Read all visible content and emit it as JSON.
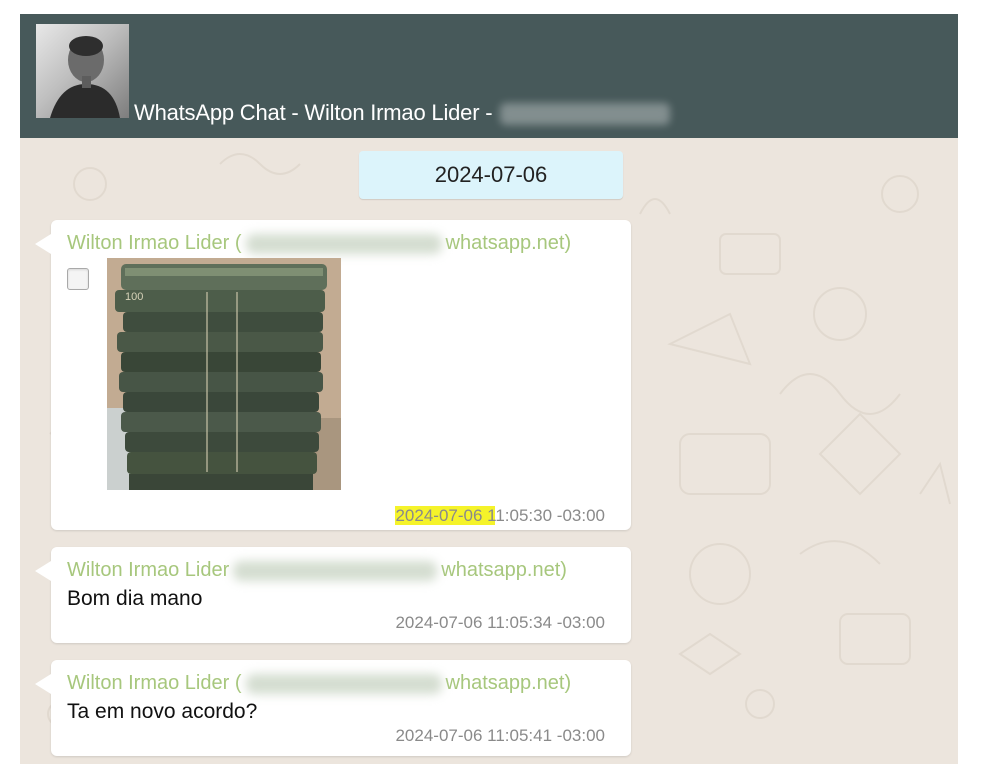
{
  "chat": {
    "title": "WhatsApp Chat - Wilton Irmao Lider -",
    "date_separator": "2024-07-06"
  },
  "messages": [
    {
      "sender": "Wilton Irmao Lider (",
      "sender_suffix": "whatsapp.net)",
      "type": "image",
      "attachment_icon": "checkbox-icon",
      "timestamp_highlight": "2024-07-06 1",
      "timestamp_rest": "1:05:30 -03:00"
    },
    {
      "sender": "Wilton Irmao Lider",
      "sender_suffix": "whatsapp.net)",
      "type": "text",
      "text": "Bom dia mano",
      "timestamp": "2024-07-06 11:05:34 -03:00"
    },
    {
      "sender": "Wilton Irmao Lider (",
      "sender_suffix": "whatsapp.net)",
      "type": "text",
      "text": "Ta em novo acordo?",
      "timestamp": "2024-07-06 11:05:41 -03:00"
    }
  ],
  "colors": {
    "header": "#47595a",
    "chat_background": "#ece5dd",
    "date_chip": "#dcf4fb",
    "sender_name": "#a7c77d",
    "timestamp": "#8a8a8a",
    "highlight": "#f5f32a"
  }
}
